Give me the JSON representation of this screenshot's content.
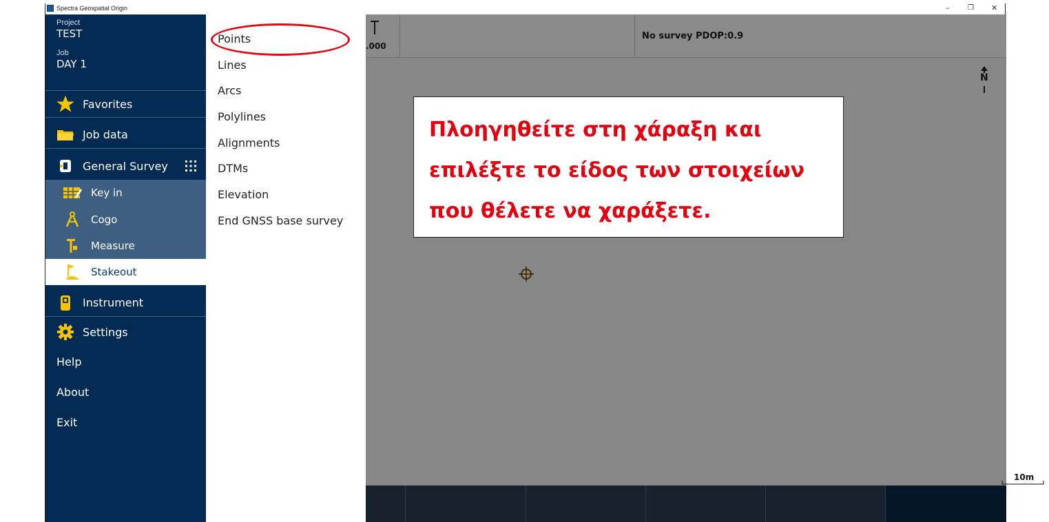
{
  "window": {
    "title": "Spectra Geospatial Origin"
  },
  "sidebar": {
    "project_label": "Project",
    "project_value": "TEST",
    "job_label": "Job",
    "job_value": "DAY 1",
    "items": {
      "favorites": "Favorites",
      "job_data": "Job data",
      "general_survey": "General Survey",
      "key_in": "Key in",
      "cogo": "Cogo",
      "measure": "Measure",
      "stakeout": "Stakeout",
      "instrument": "Instrument",
      "settings": "Settings",
      "help": "Help",
      "about": "About",
      "exit": "Exit"
    }
  },
  "submenu": {
    "items": [
      "Points",
      "Lines",
      "Arcs",
      "Polylines",
      "Alignments",
      "DTMs",
      "Elevation",
      "End GNSS base survey"
    ]
  },
  "statusbar": {
    "height_value": ".000",
    "survey_status": "No survey  PDOP:0.9"
  },
  "map": {
    "north_label": "N",
    "scale_label": "10m"
  },
  "callout": {
    "lines": [
      "Πλοηγηθείτε στη χάραξη και",
      "επιλέξτε το είδος των στοιχείων",
      "που θέλετε να χαράξετε."
    ]
  },
  "colors": {
    "sidebar_bg": "#032a52",
    "sub_panel_bg": "#3e5f82",
    "accent_yellow": "#f5c400",
    "callout_text": "#e4000f",
    "highlight_ellipse": "#e00a14"
  }
}
